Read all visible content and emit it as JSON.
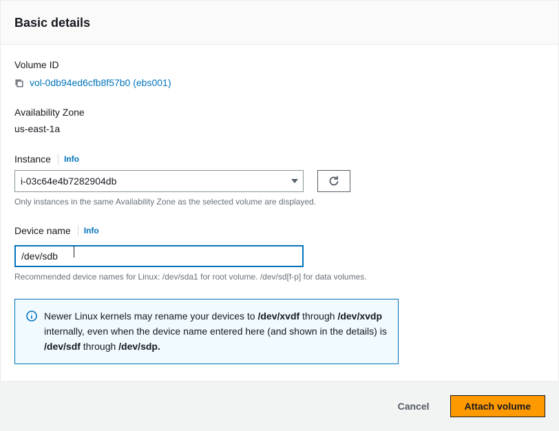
{
  "panel": {
    "title": "Basic details"
  },
  "volumeId": {
    "label": "Volume ID",
    "value": "vol-0db94ed6cfb8f57b0 (ebs001)"
  },
  "availabilityZone": {
    "label": "Availability Zone",
    "value": "us-east-1a"
  },
  "instance": {
    "label": "Instance",
    "infoLabel": "Info",
    "value": "i-03c64e4b7282904db",
    "helpText": "Only instances in the same Availability Zone as the selected volume are displayed."
  },
  "deviceName": {
    "label": "Device name",
    "infoLabel": "Info",
    "value": "/dev/sdb",
    "helpText": "Recommended device names for Linux: /dev/sda1 for root volume. /dev/sd[f-p] for data volumes."
  },
  "infoBox": {
    "text1": "Newer Linux kernels may rename your devices to ",
    "bold1": "/dev/xvdf",
    "text2": " through ",
    "bold2": "/dev/xvdp",
    "text3": " internally, even when the device name entered here (and shown in the details) is ",
    "bold3": "/dev/sdf",
    "text4": " through ",
    "bold4": "/dev/sdp."
  },
  "footer": {
    "cancel": "Cancel",
    "attach": "Attach volume"
  }
}
